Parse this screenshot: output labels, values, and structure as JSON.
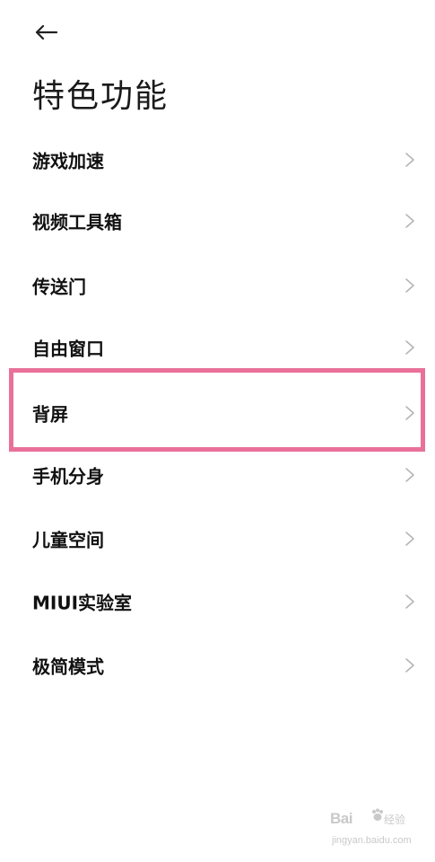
{
  "header": {
    "back_icon": "arrow-left-icon",
    "title": "特色功能"
  },
  "menu": {
    "chevron_icon": "chevron-right-icon",
    "items": [
      {
        "label": "游戏加速"
      },
      {
        "label": "视频工具箱"
      },
      {
        "label": "传送门"
      },
      {
        "label": "自由窗口"
      },
      {
        "label": "背屏",
        "highlighted": true
      },
      {
        "label": "手机分身"
      },
      {
        "label": "儿童空间"
      },
      {
        "label": "MIUI实验室"
      },
      {
        "label": "极简模式"
      }
    ]
  },
  "highlight": {
    "color": "#e9709a",
    "target": "背屏"
  },
  "watermark": {
    "brand": "Bai",
    "brand_suffix": "经验",
    "url": "jingyan.baidu.com"
  }
}
